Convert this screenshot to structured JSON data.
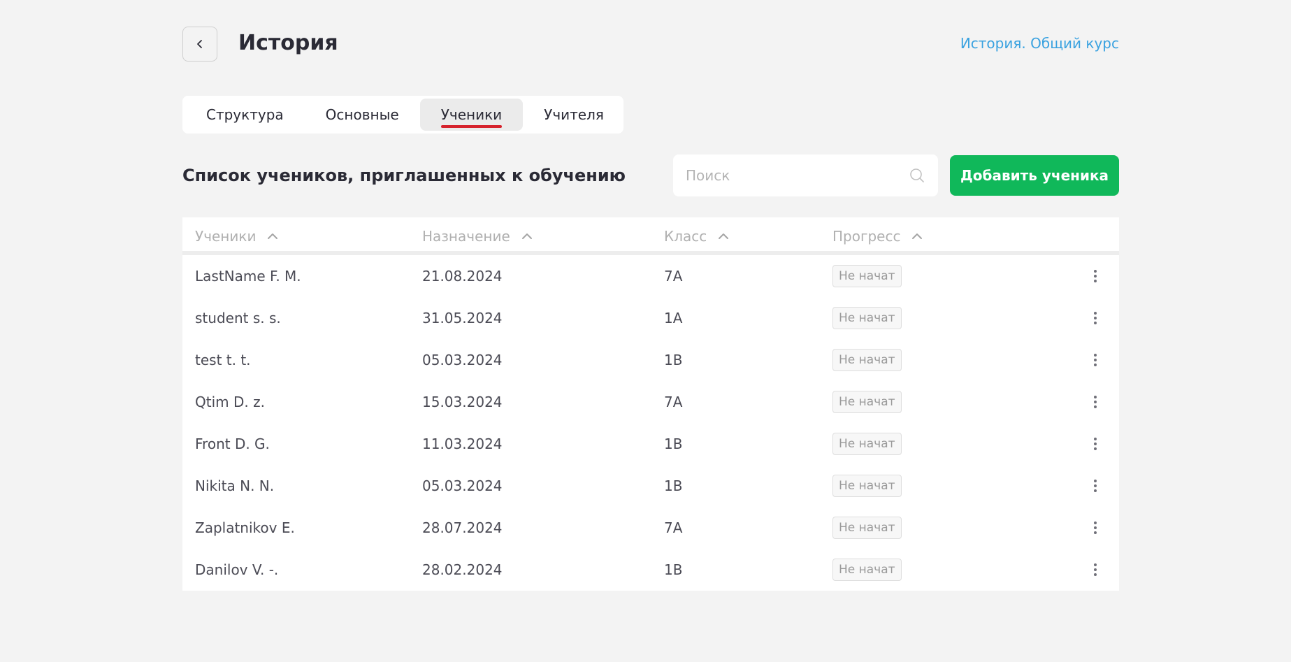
{
  "header": {
    "title": "История",
    "course_link": "История. Общий курс"
  },
  "tabs": [
    {
      "label": "Структура",
      "active": false
    },
    {
      "label": "Основные",
      "active": false
    },
    {
      "label": "Ученики",
      "active": true
    },
    {
      "label": "Учителя",
      "active": false
    }
  ],
  "section": {
    "title": "Список учеников, приглашенных к обучению",
    "search_placeholder": "Поиск",
    "add_button": "Добавить ученика"
  },
  "table": {
    "columns": [
      "Ученики",
      "Назначение",
      "Класс",
      "Прогресс"
    ],
    "rows": [
      {
        "name": "LastName F. M.",
        "date": "21.08.2024",
        "class": "7A",
        "progress": "Не начат"
      },
      {
        "name": "student s. s.",
        "date": "31.05.2024",
        "class": "1A",
        "progress": "Не начат"
      },
      {
        "name": "test t. t.",
        "date": "05.03.2024",
        "class": "1B",
        "progress": "Не начат"
      },
      {
        "name": "Qtim D. z.",
        "date": "15.03.2024",
        "class": "7A",
        "progress": "Не начат"
      },
      {
        "name": "Front D. G.",
        "date": "11.03.2024",
        "class": "1B",
        "progress": "Не начат"
      },
      {
        "name": "Nikita N. N.",
        "date": "05.03.2024",
        "class": "1B",
        "progress": "Не начат"
      },
      {
        "name": "Zaplatnikov E.",
        "date": "28.07.2024",
        "class": "7A",
        "progress": "Не начат"
      },
      {
        "name": "Danilov V. -.",
        "date": "28.02.2024",
        "class": "1B",
        "progress": "Не начат"
      }
    ]
  },
  "colors": {
    "accent_green": "#10b85a",
    "link_blue": "#3aa2e0",
    "active_tab_underline": "#d6232d",
    "background": "#f3f3f3"
  },
  "icons": {
    "back": "chevron-left-icon",
    "search": "search-icon",
    "sort": "chevron-up-icon",
    "row_menu": "more-vertical-icon"
  }
}
